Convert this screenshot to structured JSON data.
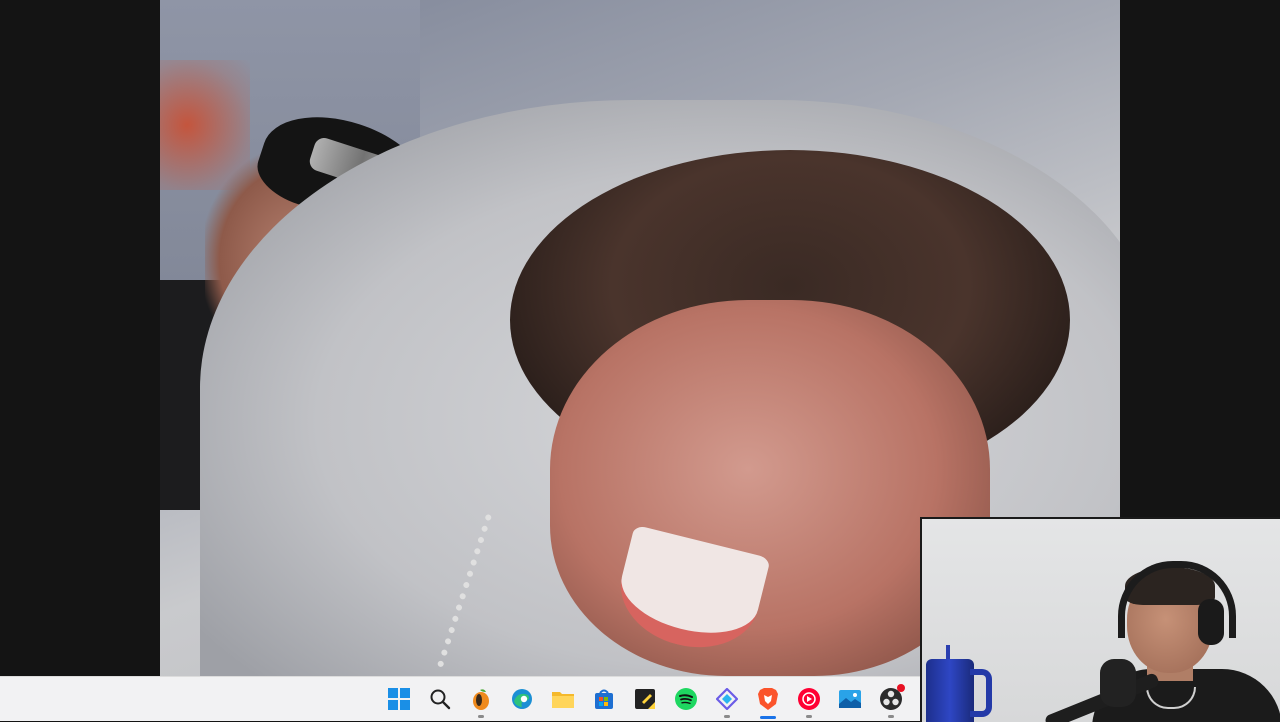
{
  "window": {
    "content": "fullscreen-video",
    "video_description_hidden": true
  },
  "taskbar": {
    "pinned": [
      {
        "id": "start",
        "icon": "windows-start-icon"
      },
      {
        "id": "search",
        "icon": "search-icon"
      },
      {
        "id": "fl-studio",
        "icon": "fl-studio-icon"
      },
      {
        "id": "edge",
        "icon": "edge-icon"
      },
      {
        "id": "file-explorer",
        "icon": "folder-icon"
      },
      {
        "id": "store",
        "icon": "store-icon"
      },
      {
        "id": "sticky-notes",
        "icon": "sticky-notes-icon"
      },
      {
        "id": "spotify",
        "icon": "spotify-icon"
      },
      {
        "id": "app-diamond",
        "icon": "diamond-app-icon"
      },
      {
        "id": "brave",
        "icon": "brave-icon",
        "active": true
      },
      {
        "id": "youtube-music",
        "icon": "youtube-music-icon"
      },
      {
        "id": "photos",
        "icon": "photos-icon"
      },
      {
        "id": "obs",
        "icon": "obs-icon",
        "badge": true
      }
    ],
    "accent_color": "#1a73e8",
    "badge_color": "#e81123"
  },
  "webcam": {
    "position_word": "bottom-right"
  }
}
